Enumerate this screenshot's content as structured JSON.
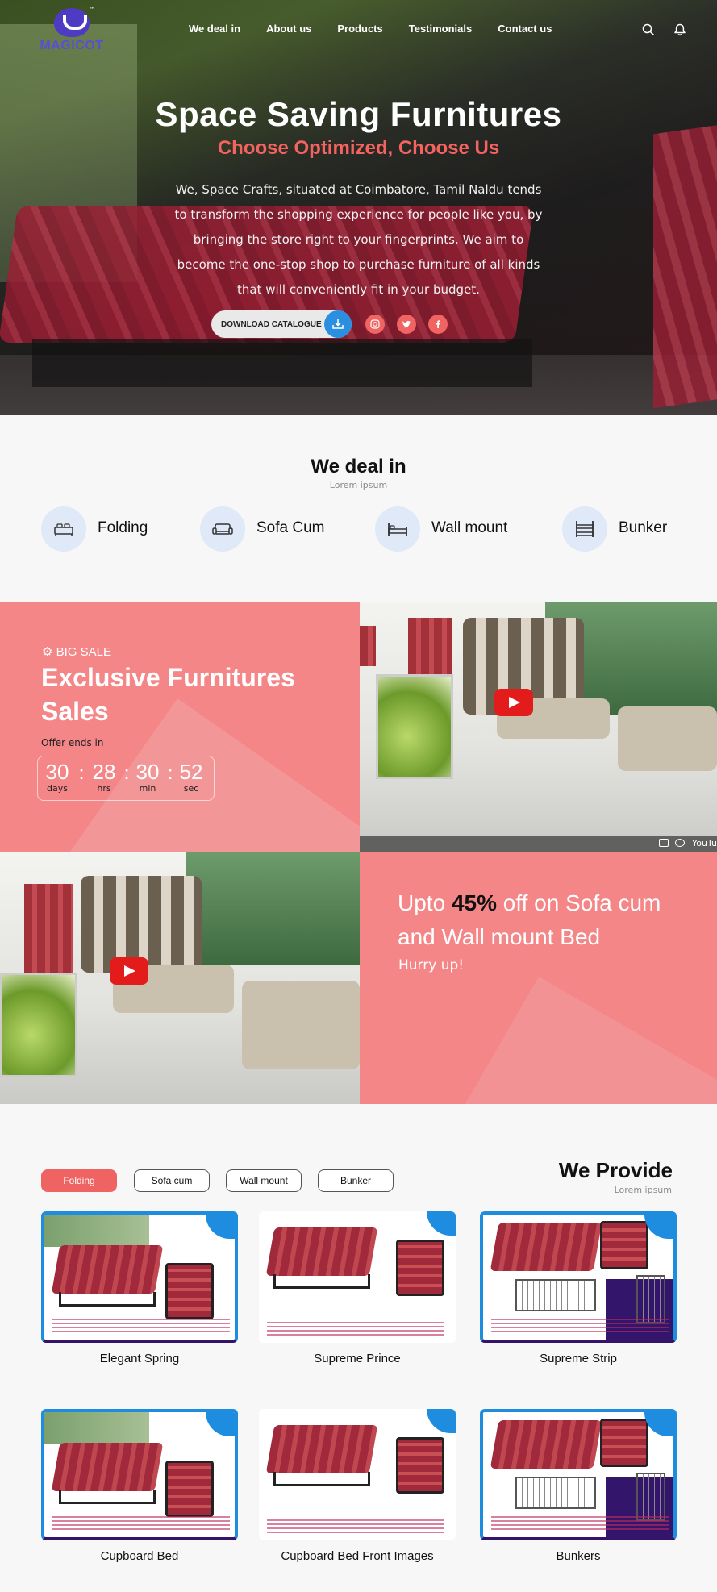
{
  "brand": {
    "logo_text": "MAGICOT",
    "tm": "™",
    "color": "#5a4ed6"
  },
  "nav": {
    "links": [
      "We deal in",
      "About us",
      "Products",
      "Testimonials",
      "Contact us"
    ],
    "icons": [
      "search-icon",
      "bell-icon"
    ]
  },
  "hero": {
    "title": "Space Saving Furnitures",
    "subtitle": "Choose Optimized, Choose Us",
    "description": "We, Space Crafts, situated at Coimbatore, Tamil Naldu tends to transform the shopping experience for people like you, by  bringing the store right to your fingerprints. We aim to become the one-stop shop to purchase furniture of all kinds that will conveniently fit in your budget.",
    "download_label": "DOWNLOAD CATALOGUE",
    "social": [
      "instagram-icon",
      "twitter-icon",
      "facebook-icon"
    ],
    "accent": "#f4635f"
  },
  "deal_in": {
    "title": "We deal in",
    "subtitle": "Lorem ipsum",
    "items": [
      "Folding",
      "Sofa Cum",
      "Wall mount",
      "Bunker"
    ]
  },
  "sale": {
    "badge_icon": "⚙",
    "badge": "BIG SALE",
    "title": "Exclusive Furnitures Sales",
    "offer_label": "Offer ends in",
    "countdown": [
      {
        "value": "30",
        "unit": "days"
      },
      {
        "value": "28",
        "unit": "hrs"
      },
      {
        "value": "30",
        "unit": "min"
      },
      {
        "value": "52",
        "unit": "sec"
      }
    ],
    "bg_color": "#f48688"
  },
  "video": {
    "watermark": "YouTu"
  },
  "offer": {
    "prefix": "Upto ",
    "highlight": "45%",
    "suffix": " off on Sofa cum and Wall mount Bed",
    "hurry": "Hurry up!"
  },
  "provide": {
    "filters": [
      "Folding",
      "Sofa cum",
      "Wall mount",
      "Bunker"
    ],
    "active_filter": "Folding",
    "title": "We Provide",
    "subtitle": "Lorem ipsum",
    "products": [
      "Elegant Spring",
      "Supreme Prince",
      "Supreme Strip",
      "Cupboard Bed",
      "Cupboard Bed Front Images",
      "Bunkers"
    ]
  }
}
